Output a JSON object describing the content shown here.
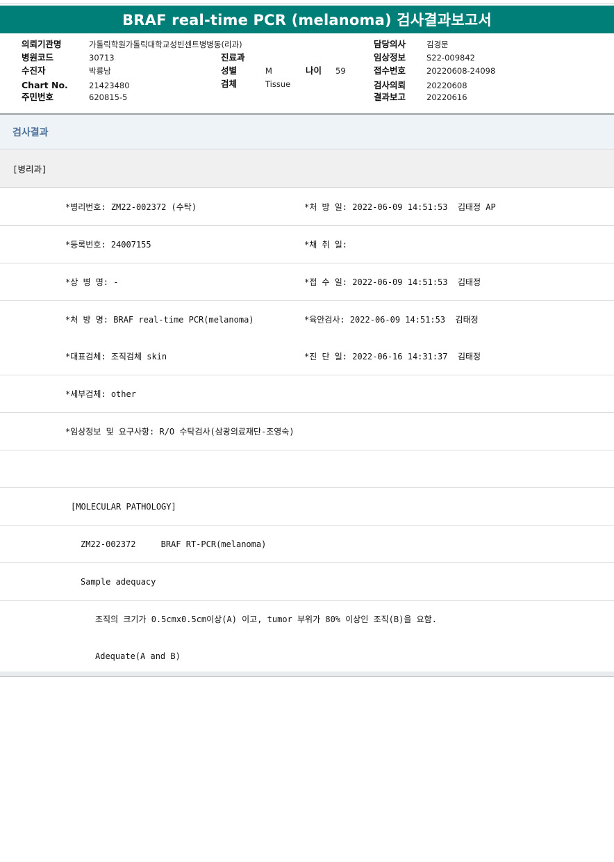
{
  "title": "BRAF real-time PCR (melanoma) 검사결과보고서",
  "header": {
    "hospital_label": "의뢰기관명",
    "hospital_value": "가톨릭학원가톨릭대학교성빈센트병병동(리과)",
    "code_label": "병원코드",
    "code_value": "30713",
    "dept_label": "진료과",
    "patient_label": "수진자",
    "patient_value": "박룡남",
    "sex_label": "성별",
    "sex_value": "M",
    "age_label": "나이",
    "age_value": "59",
    "chart_label": "Chart No.",
    "chart_value": "21423480",
    "specimen_label": "검체",
    "specimen_value": "Tissue",
    "rrn_label": "주민번호",
    "rrn_value": "620815-5",
    "doctor_label": "담당의사",
    "doctor_value": "김경문",
    "clinical_label": "임상정보",
    "clinical_value": "S22-009842",
    "receipt_label": "접수번호",
    "receipt_value": "20220608-24098",
    "request_label": "검사의뢰",
    "request_value": "20220608",
    "report_label": "결과보고",
    "report_value": "20220616"
  },
  "section_title": "검사결과",
  "department": "[병리과]",
  "rows": [
    {
      "left": "*병리번호: ZM22-002372 (수탁)",
      "right": "*처 방 일: 2022-06-09 14:51:53  김태정 AP"
    },
    {
      "left": "*등록번호: 24007155",
      "right": "*채 취 일:"
    },
    {
      "left": "*상 병 명: -",
      "right": "*접 수 일: 2022-06-09 14:51:53  김태정"
    },
    {
      "left": "*처 방 명: BRAF real-time PCR(melanoma)",
      "right": "*육안검사: 2022-06-09 14:51:53  김태정"
    },
    {
      "left": "*대표검체: 조직검체 skin",
      "right": "*진 단 일: 2022-06-16 14:31:37  김태정"
    },
    {
      "left": "*세부검체: other",
      "right": ""
    },
    {
      "left": "*임상정보 및 요구사항: R/O 수탁검사(삼광의료재단-조영숙)",
      "right": ""
    },
    {
      "left": "",
      "right": ""
    }
  ],
  "report_lines": [
    "[MOLECULAR PATHOLOGY]",
    "ZM22-002372     BRAF RT-PCR(melanoma)",
    "Sample adequacy",
    "조직의 크기가 0.5cmx0.5cm이상(A) 이고, tumor 부위가 80% 이상인 조직(B)을 요함.",
    "Adequate(A and B)"
  ]
}
